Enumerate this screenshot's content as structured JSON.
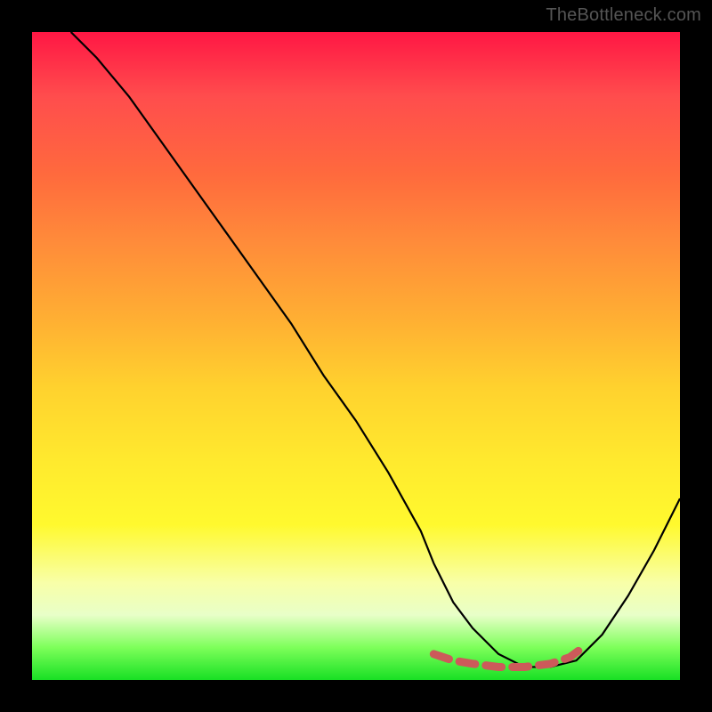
{
  "watermark": {
    "text": "TheBottleneck.com"
  },
  "chart_data": {
    "type": "line",
    "title": "",
    "xlabel": "",
    "ylabel": "",
    "xlim": [
      0,
      100
    ],
    "ylim": [
      0,
      100
    ],
    "grid": false,
    "legend": false,
    "background_gradient": {
      "direction": "vertical",
      "stops": [
        {
          "pos": 0.0,
          "color": "#ff1744"
        },
        {
          "pos": 0.1,
          "color": "#ff4d4d"
        },
        {
          "pos": 0.22,
          "color": "#ff6a3d"
        },
        {
          "pos": 0.32,
          "color": "#ff8a3a"
        },
        {
          "pos": 0.44,
          "color": "#ffae33"
        },
        {
          "pos": 0.55,
          "color": "#ffd22e"
        },
        {
          "pos": 0.66,
          "color": "#ffe92e"
        },
        {
          "pos": 0.76,
          "color": "#fff92e"
        },
        {
          "pos": 0.85,
          "color": "#f8ffa8"
        },
        {
          "pos": 0.9,
          "color": "#e8ffc8"
        },
        {
          "pos": 0.95,
          "color": "#7dff5a"
        },
        {
          "pos": 1.0,
          "color": "#18e024"
        }
      ]
    },
    "series": [
      {
        "name": "main-curve",
        "style": {
          "stroke": "#000000",
          "width": 2.2,
          "dash": "solid"
        },
        "x": [
          6,
          10,
          15,
          20,
          25,
          30,
          35,
          40,
          45,
          50,
          55,
          60,
          62,
          65,
          68,
          72,
          76,
          80,
          84,
          88,
          92,
          96,
          100
        ],
        "y": [
          100,
          96,
          90,
          83,
          76,
          69,
          62,
          55,
          47,
          40,
          32,
          23,
          18,
          12,
          8,
          4,
          2,
          2,
          3,
          7,
          13,
          20,
          28
        ]
      },
      {
        "name": "highlight-region",
        "style": {
          "stroke": "#cc5a5a",
          "width": 9,
          "dash": "dashed"
        },
        "x": [
          62,
          65,
          68,
          72,
          76,
          80,
          83,
          85
        ],
        "y": [
          4,
          3,
          2.5,
          2,
          2,
          2.5,
          3.5,
          5
        ]
      }
    ],
    "annotations": []
  }
}
